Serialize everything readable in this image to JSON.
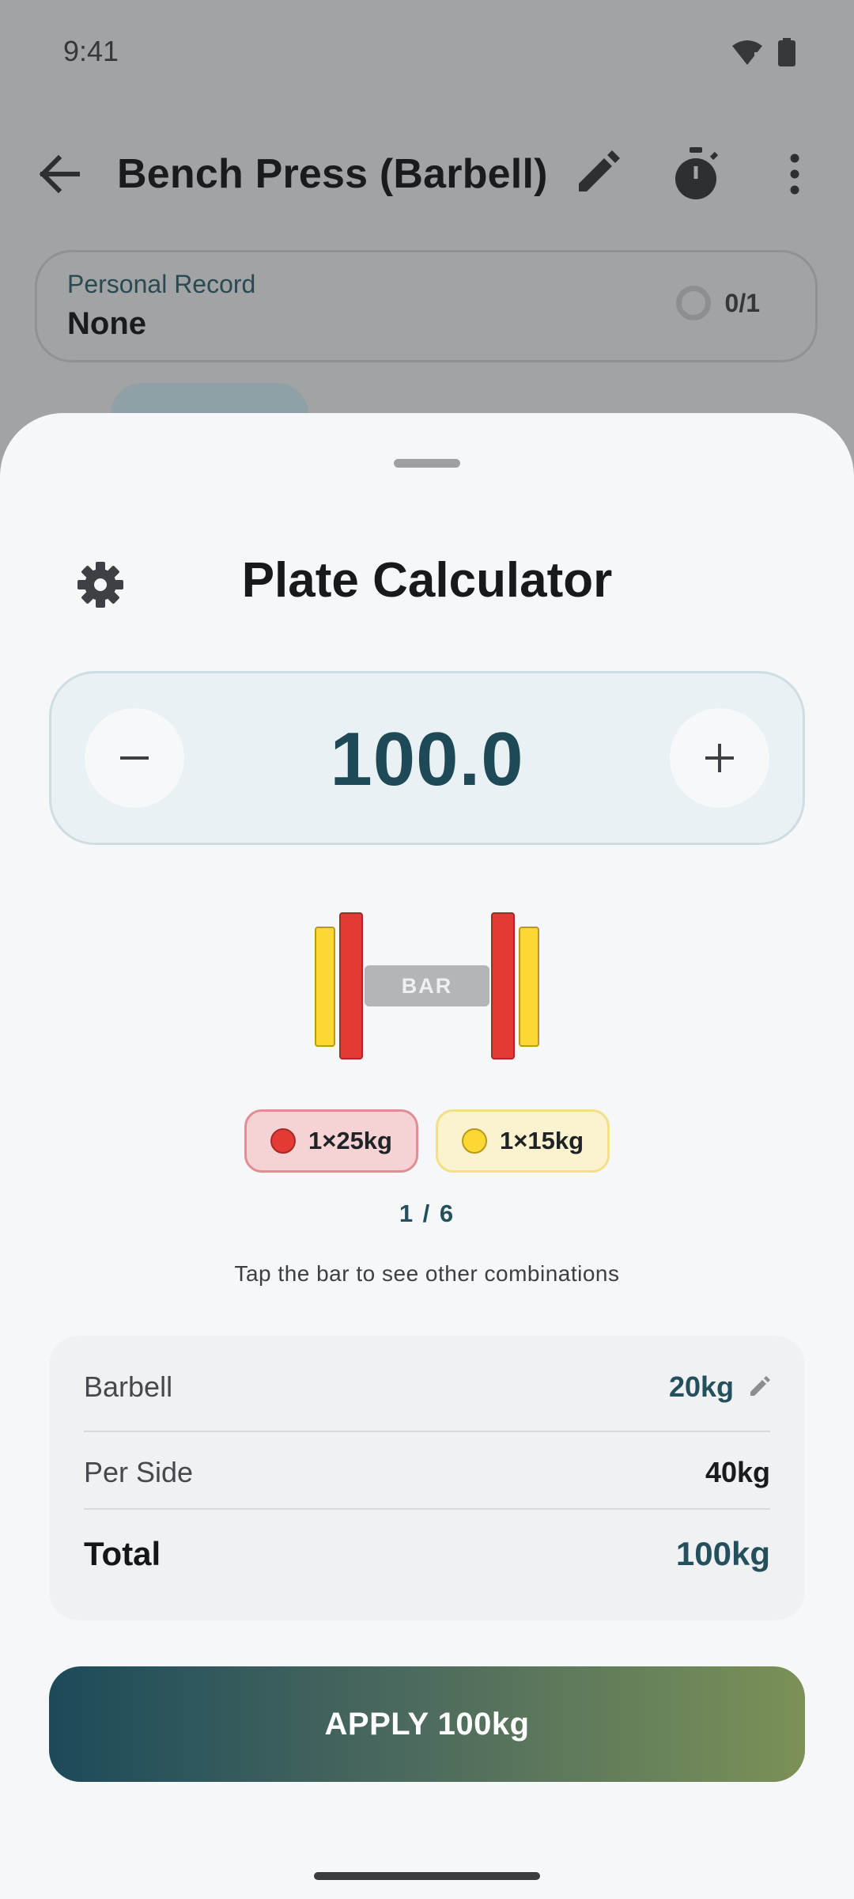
{
  "status_bar": {
    "time": "9:41"
  },
  "background_screen": {
    "title": "Bench Press (Barbell)",
    "personal_record": {
      "label": "Personal Record",
      "value": "None",
      "progress": "0/1"
    }
  },
  "sheet": {
    "title": "Plate Calculator",
    "weight_value": "100.0",
    "bar_label": "BAR",
    "plates": [
      {
        "label": "1×25kg",
        "color": "#e53935"
      },
      {
        "label": "1×15kg",
        "color": "#fdd835"
      }
    ],
    "combination_index": "1 / 6",
    "hint": "Tap the bar to see other combinations",
    "summary": {
      "barbell_label": "Barbell",
      "barbell_value": "20kg",
      "per_side_label": "Per Side",
      "per_side_value": "40kg",
      "total_label": "Total",
      "total_value": "100kg"
    },
    "apply_label": "APPLY 100kg"
  },
  "colors": {
    "accent": "#1e4a58",
    "plate_red": "#e53935",
    "plate_yellow": "#fdd835",
    "scrim": "#a2a3a4"
  }
}
